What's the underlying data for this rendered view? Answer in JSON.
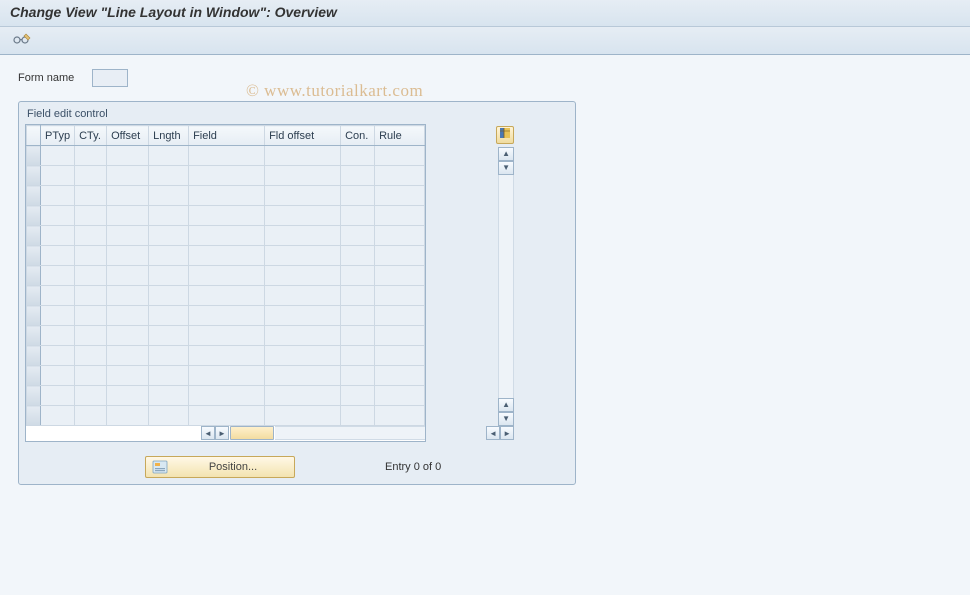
{
  "title": "Change View \"Line Layout in Window\": Overview",
  "watermark": "© www.tutorialkart.com",
  "form": {
    "label": "Form name",
    "value": ""
  },
  "groupbox": {
    "title": "Field edit control"
  },
  "table": {
    "columns": [
      "PTyp",
      "CTy.",
      "Offset",
      "Lngth",
      "Field",
      "Fld offset",
      "Con.",
      "Rule"
    ],
    "rows": 14
  },
  "footer": {
    "position_label": "Position...",
    "entry_text": "Entry 0 of 0"
  }
}
